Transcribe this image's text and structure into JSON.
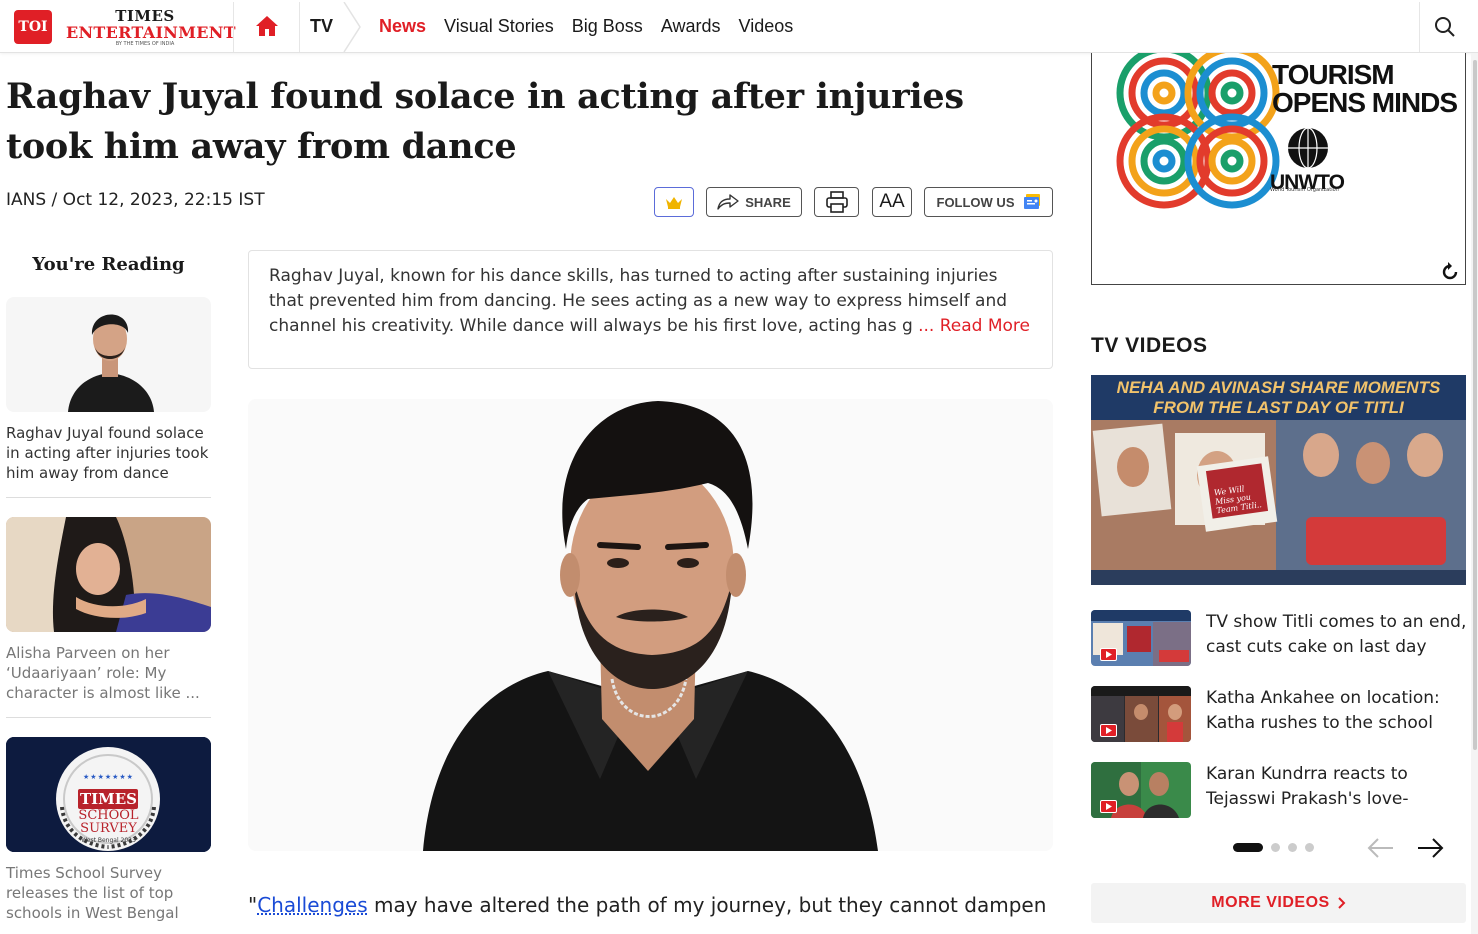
{
  "header": {
    "logo_abbr": "TOI",
    "brand_line1": "TIMES",
    "brand_line2": "ENTERTAINMENT",
    "brand_line3": "BY THE TIMES OF INDIA",
    "section": "TV",
    "nav": [
      "News",
      "Visual Stories",
      "Big Boss",
      "Awards",
      "Videos"
    ],
    "active_nav": "News"
  },
  "article": {
    "title": "Raghav Juyal found solace in acting after injuries took him away from dance",
    "byline": "IANS / Oct 12, 2023, 22:15 IST",
    "share_label": "SHARE",
    "font_label": "AA",
    "follow_label": "FOLLOW US",
    "summary": "Raghav Juyal, known for his dance skills, has turned to acting after sustaining injuries that prevented him from dancing. He sees acting as a new way to express himself and channel his creativity. While dance will always be his first love, acting has given him a new purpose.",
    "read_more": "... Read More",
    "quote_open": "\"",
    "quote_link": "Challenges",
    "quote_rest": " may have altered the path of my journey, but they cannot dampen"
  },
  "left_rail": {
    "title": "You're Reading",
    "items": [
      {
        "text": "Raghav Juyal found solace in acting after injuries took him away from dance",
        "current": true
      },
      {
        "text": "Alisha Parveen on her ‘Udaariyaan’ role: My character is almost like ...",
        "current": false
      },
      {
        "text": "Times School Survey releases the list of top schools in West Bengal",
        "current": false
      }
    ],
    "survey_badge": {
      "line1": "TIMES",
      "line2": "SCHOOL",
      "line3": "SURVEY",
      "line4": "West Bengal 2023"
    }
  },
  "ad": {
    "line1": "TOURISM",
    "line2": "OPENS MINDS",
    "org": "UNWTO",
    "org_sub": "World Tourism Organization"
  },
  "tv_videos": {
    "title": "TV VIDEOS",
    "feature_line1": "NEHA AND AVINASH SHARE MOMENTS",
    "feature_line2": "FROM THE LAST DAY OF TITLI",
    "feature_card_text": "We Will Miss you Team Titli..",
    "items": [
      {
        "title": "TV show Titli comes to an end, cast cuts cake on last day"
      },
      {
        "title": "Katha Ankahee on location: Katha rushes to the school"
      },
      {
        "title": "Karan Kundrra reacts to Tejasswi Prakash's love-"
      }
    ],
    "pager_count": 4,
    "pager_active": 1,
    "more_label": "MORE VIDEOS"
  },
  "colors": {
    "brand_red": "#e01f26",
    "link_blue": "#1a4bd6"
  }
}
